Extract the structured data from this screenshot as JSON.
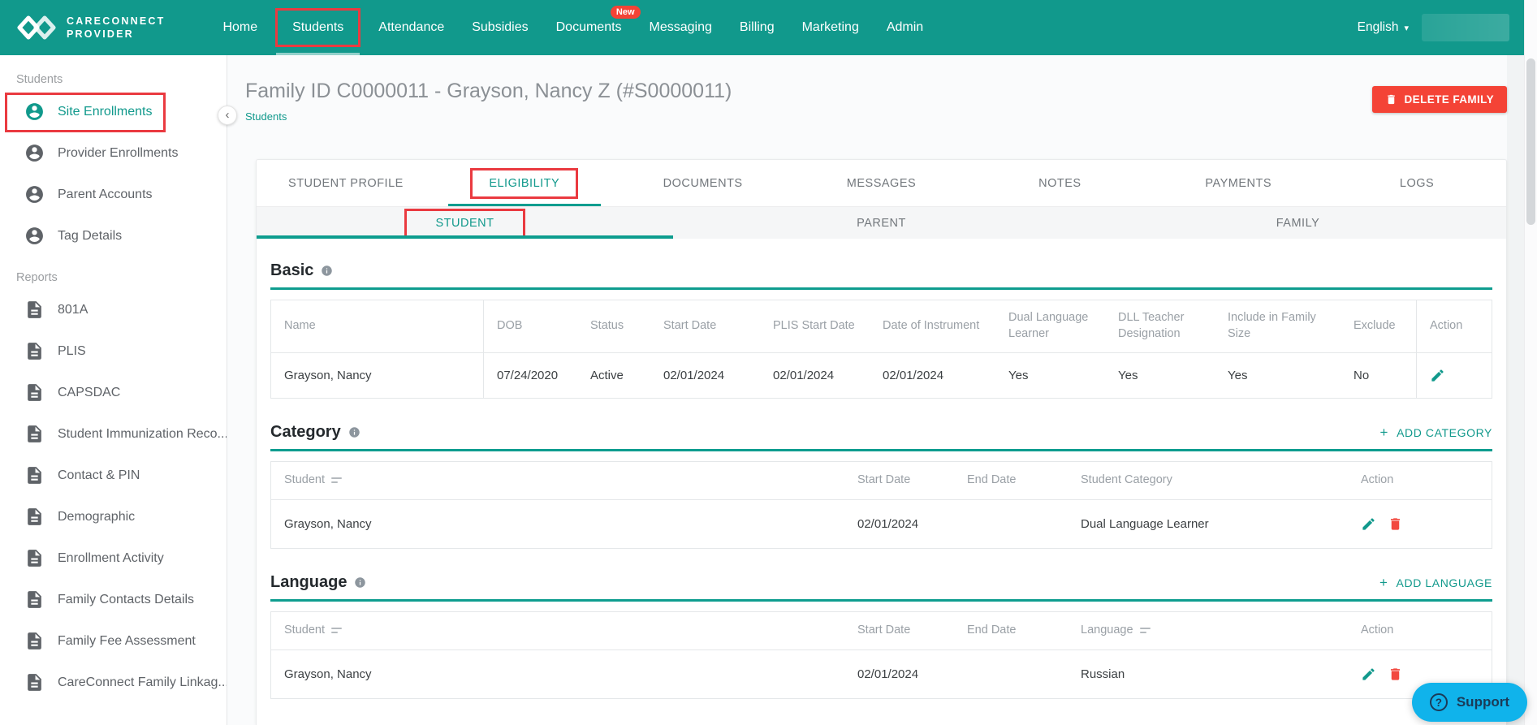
{
  "colors": {
    "accent_teal": "#11998c",
    "annotation_red": "#ea3a40",
    "danger_red": "#f44336",
    "support_blue": "#10b3eb"
  },
  "brand": {
    "line1": "CARECONNECT",
    "line2": "PROVIDER"
  },
  "navbar": {
    "items": [
      {
        "label": "Home"
      },
      {
        "label": "Students",
        "active": true,
        "annotated": true
      },
      {
        "label": "Attendance"
      },
      {
        "label": "Subsidies"
      },
      {
        "label": "Documents",
        "badge": "New"
      },
      {
        "label": "Messaging"
      },
      {
        "label": "Billing"
      },
      {
        "label": "Marketing"
      },
      {
        "label": "Admin"
      }
    ],
    "language": "English"
  },
  "sidebar": {
    "sections": [
      {
        "label": "Students",
        "items": [
          {
            "label": "Site Enrollments",
            "active": true,
            "annotated": true
          },
          {
            "label": "Provider Enrollments"
          },
          {
            "label": "Parent Accounts"
          },
          {
            "label": "Tag Details"
          }
        ]
      },
      {
        "label": "Reports",
        "items": [
          {
            "label": "801A"
          },
          {
            "label": "PLIS"
          },
          {
            "label": "CAPSDAC"
          },
          {
            "label": "Student Immunization Reco..."
          },
          {
            "label": "Contact & PIN"
          },
          {
            "label": "Demographic"
          },
          {
            "label": "Enrollment Activity"
          },
          {
            "label": "Family Contacts Details"
          },
          {
            "label": "Family Fee Assessment"
          },
          {
            "label": "CareConnect Family Linkag..."
          }
        ]
      }
    ]
  },
  "page": {
    "title": "Family ID C0000011 - Grayson, Nancy Z (#S0000011)",
    "breadcrumb": "Students",
    "delete_label": "DELETE FAMILY"
  },
  "tabs": [
    "STUDENT PROFILE",
    "ELIGIBILITY",
    "DOCUMENTS",
    "MESSAGES",
    "NOTES",
    "PAYMENTS",
    "LOGS"
  ],
  "subtabs": [
    "STUDENT",
    "PARENT",
    "FAMILY"
  ],
  "sections": {
    "basic": {
      "title": "Basic",
      "columns": [
        "Name",
        "DOB",
        "Status",
        "Start Date",
        "PLIS Start Date",
        "Date of Instrument",
        "Dual Language Learner",
        "DLL Teacher Designation",
        "Include in Family Size",
        "Exclude",
        "Action"
      ],
      "row": [
        "Grayson, Nancy",
        "07/24/2020",
        "Active",
        "02/01/2024",
        "02/01/2024",
        "02/01/2024",
        "Yes",
        "Yes",
        "Yes",
        "No"
      ]
    },
    "category": {
      "title": "Category",
      "plus": "+",
      "add_label": "ADD CATEGORY",
      "columns": [
        "Student",
        "Start Date",
        "End Date",
        "Student Category",
        "Action"
      ],
      "row": [
        "Grayson, Nancy",
        "02/01/2024",
        "",
        "Dual Language Learner"
      ]
    },
    "language": {
      "title": "Language",
      "plus": "+",
      "add_label": "ADD LANGUAGE",
      "columns": [
        "Student",
        "Start Date",
        "End Date",
        "Language",
        "Action"
      ],
      "row": [
        "Grayson, Nancy",
        "02/01/2024",
        "",
        "Russian"
      ]
    }
  },
  "support": {
    "label": "Support"
  }
}
